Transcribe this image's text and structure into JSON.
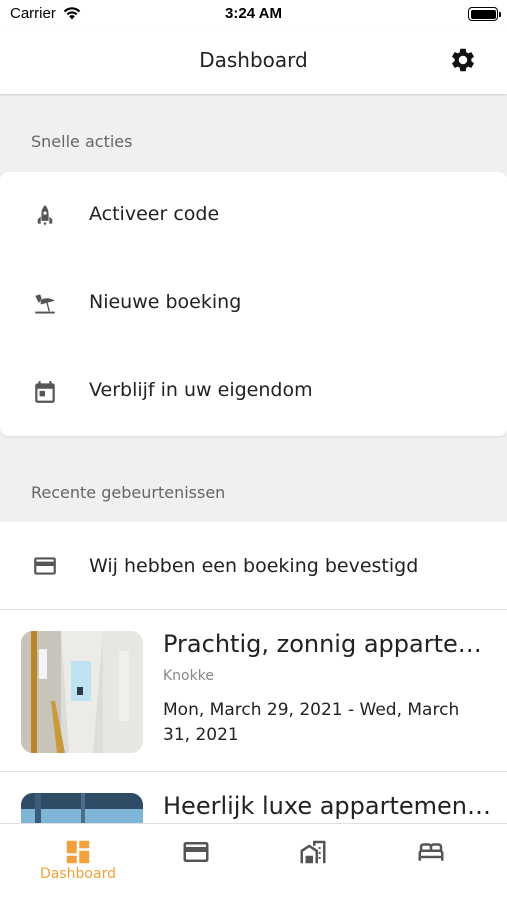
{
  "status_bar": {
    "carrier": "Carrier",
    "time": "3:24 AM"
  },
  "nav": {
    "title": "Dashboard",
    "settings_icon": "gear-icon"
  },
  "quick_actions": {
    "header": "Snelle acties",
    "items": [
      {
        "label": "Activeer code",
        "icon": "rocket-icon"
      },
      {
        "label": "Nieuwe boeking",
        "icon": "beach-umbrella-icon"
      },
      {
        "label": "Verblijf in uw eigendom",
        "icon": "calendar-icon"
      }
    ]
  },
  "recent_events": {
    "header": "Recente gebeurtenissen",
    "items": [
      {
        "label": "Wij hebben een boeking bevestigd",
        "icon": "credit-card-icon"
      }
    ],
    "bookings": [
      {
        "title": "Prachtig, zonnig apparte…",
        "city": "Knokke",
        "dates": "Mon, March 29, 2021 - Wed, March 31, 2021"
      },
      {
        "title": "Heerlijk luxe appartemen…",
        "city": "",
        "dates": ""
      }
    ]
  },
  "tab_bar": {
    "accent_color": "#f0a23c",
    "tabs": [
      {
        "label": "Dashboard",
        "icon": "dashboard-icon",
        "active": true
      },
      {
        "label": "",
        "icon": "credit-card-icon",
        "active": false
      },
      {
        "label": "",
        "icon": "buildings-icon",
        "active": false
      },
      {
        "label": "",
        "icon": "bed-icon",
        "active": false
      }
    ]
  }
}
